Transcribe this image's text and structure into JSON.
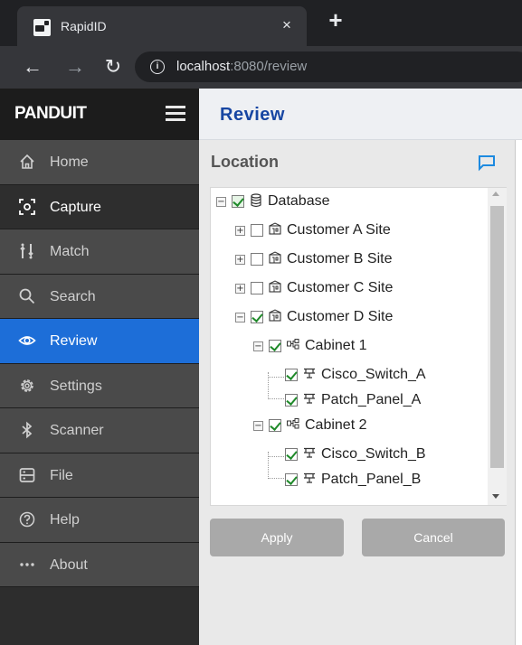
{
  "browser": {
    "tab_title": "RapidID",
    "tab_close": "×",
    "new_tab": "+",
    "url_host": "localhost",
    "url_rest": ":8080/review"
  },
  "app": {
    "brand": "PANDUIT"
  },
  "sidebar": {
    "items": [
      {
        "label": "Home",
        "icon": "home-icon"
      },
      {
        "label": "Capture",
        "icon": "capture-icon"
      },
      {
        "label": "Match",
        "icon": "match-icon"
      },
      {
        "label": "Search",
        "icon": "search-icon"
      },
      {
        "label": "Review",
        "icon": "eye-icon"
      },
      {
        "label": "Settings",
        "icon": "gear-icon"
      },
      {
        "label": "Scanner",
        "icon": "bluetooth-icon"
      },
      {
        "label": "File",
        "icon": "file-icon"
      },
      {
        "label": "Help",
        "icon": "help-icon"
      },
      {
        "label": "About",
        "icon": "more-icon"
      }
    ],
    "active": "Review"
  },
  "main": {
    "title": "Review",
    "location_title": "Location",
    "tree": [
      {
        "label": "Database",
        "checked": true,
        "type": "database"
      },
      {
        "label": "Customer A Site",
        "checked": false,
        "type": "site"
      },
      {
        "label": "Customer B Site",
        "checked": false,
        "type": "site"
      },
      {
        "label": "Customer C Site",
        "checked": false,
        "type": "site"
      },
      {
        "label": "Customer D Site",
        "checked": true,
        "type": "site"
      },
      {
        "label": "Cabinet 1",
        "checked": true,
        "type": "cabinet"
      },
      {
        "label": "Cisco_Switch_A",
        "checked": true,
        "type": "device"
      },
      {
        "label": "Patch_Panel_A",
        "checked": true,
        "type": "device"
      },
      {
        "label": "Cabinet 2",
        "checked": true,
        "type": "cabinet"
      },
      {
        "label": "Cisco_Switch_B",
        "checked": true,
        "type": "device"
      },
      {
        "label": "Patch_Panel_B",
        "checked": true,
        "type": "device"
      }
    ],
    "apply_label": "Apply",
    "cancel_label": "Cancel"
  },
  "colors": {
    "accent": "#1d6ed8",
    "title": "#1746a2",
    "check": "#1f8a2a"
  }
}
